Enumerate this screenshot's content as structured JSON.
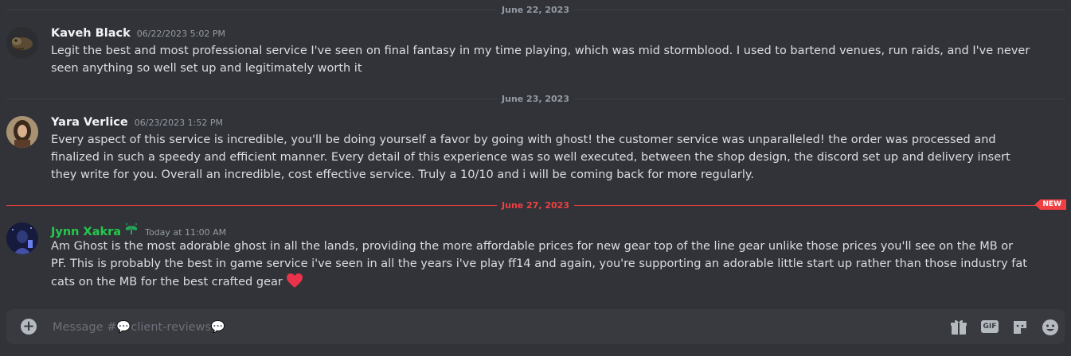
{
  "dividers": {
    "d1": "June 22, 2023",
    "d2": "June 23, 2023",
    "d3": "June 27, 2023",
    "new_badge": "NEW"
  },
  "messages": [
    {
      "username": "Kaveh Black",
      "timestamp": "06/22/2023 5:02 PM",
      "text": "Legit the best and most professional service I've seen on final fantasy in my time playing, which was mid stormblood. I used to bartend venues, run raids, and I've never seen anything so well set up and legitimately worth it"
    },
    {
      "username": "Yara Verlice",
      "timestamp": "06/23/2023 1:52 PM",
      "text": "Every aspect of this service is incredible, you'll be doing yourself a favor by going with ghost! the customer service was unparalleled! the order was processed and finalized in such a speedy and efficient manner. Every detail of this experience was so well executed, between the shop design, the discord set up and delivery insert they write for you. Overall an incredible, cost effective service. Truly a 10/10 and i will be coming back for more regularly."
    },
    {
      "username": "Jynn Xakra",
      "timestamp": "Today at 11:00 AM",
      "text": "Am Ghost is the most adorable ghost in all the lands, providing the more affordable prices for new gear top of the line gear unlike those prices you'll see on the MB or PF. This is probably the best in game service i've seen in all the years i've play ff14 and again, you're supporting an adorable little start up rather than those industry fat cats on the MB for the best crafted gear"
    }
  ],
  "composer": {
    "placeholder": "Message #💬client-reviews💬",
    "gif_label": "GIF"
  },
  "colors": {
    "background": "#313338",
    "new_red": "#f23f42",
    "green_name": "#23c94b",
    "heart": "#e8334a"
  }
}
